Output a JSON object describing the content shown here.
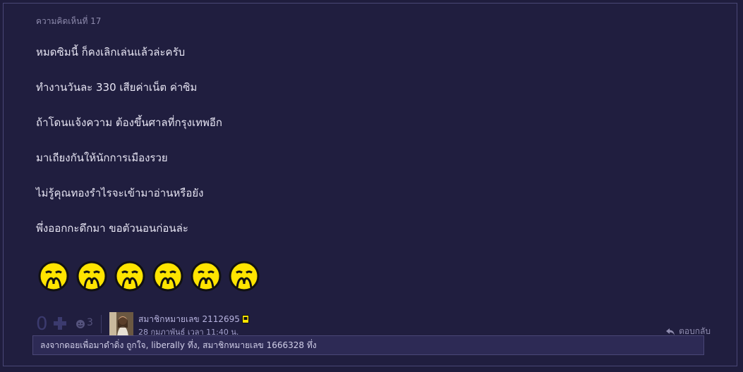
{
  "comment": {
    "number_label": "ความคิดเห็นที่ 17",
    "lines": [
      "หมดซิมนี้ ก็คงเลิกเล่นแล้วล่ะครับ",
      "ทำงานวันละ 330 เสียค่าเน็ต ค่าซิม",
      "ถ้าโดนแจ้งความ ต้องขึ้นศาลที่กรุงเทพอีก",
      "มาเถียงกันให้นักการเมืองรวย",
      "ไม่รู้คุณทองรำไรจะเข้ามาอ่านหรือยัง",
      "พึ่งออกกะดึกมา ขอตัวนอนก่อนล่ะ"
    ],
    "emoji_icon": "covering-mouth-emoji-icon"
  },
  "footer": {
    "vote_count": "0",
    "reaction_count": "3",
    "member_name": "สมาชิกหมายเลข 2112695",
    "timestamp": "28 กุมภาพันธ์ เวลา 11:40 น.",
    "reply_label": "ตอบกลับ"
  },
  "reactions": {
    "text": "ลงจากดอยเพื่อมาดำดิ่ง ถูกใจ, liberally ทึ่ง, สมาชิกหมายเลข 1666328 ทึ่ง"
  },
  "colors": {
    "background": "#201e3f",
    "border": "#4a4776",
    "text": "#e6e4f2",
    "emoji_yellow": "#ffe400"
  }
}
